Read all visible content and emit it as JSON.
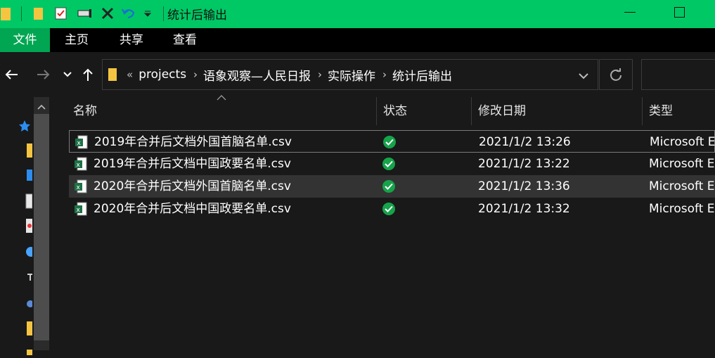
{
  "window": {
    "title": "统计后输出"
  },
  "ribbon": {
    "tabs": [
      {
        "label": "文件",
        "active": true
      },
      {
        "label": "主页",
        "active": false
      },
      {
        "label": "共享",
        "active": false
      },
      {
        "label": "查看",
        "active": false
      }
    ]
  },
  "address": {
    "overflow": "«",
    "crumbs": [
      "projects",
      "语象观察—人民日报",
      "实际操作",
      "统计后输出"
    ]
  },
  "columns": {
    "name": "名称",
    "status": "状态",
    "modified": "修改日期",
    "type": "类型"
  },
  "files": [
    {
      "name": "2019年合并后文档外国首脑名单.csv",
      "status": "synced",
      "modified": "2021/1/2 13:26",
      "type": "Microsoft E",
      "focused": true,
      "selected": false
    },
    {
      "name": "2019年合并后文档中国政要名单.csv",
      "status": "synced",
      "modified": "2021/1/2 13:22",
      "type": "Microsoft E",
      "focused": false,
      "selected": false
    },
    {
      "name": "2020年合并后文档外国首脑名单.csv",
      "status": "synced",
      "modified": "2021/1/2 13:36",
      "type": "Microsoft E",
      "focused": false,
      "selected": true
    },
    {
      "name": "2020年合并后文档中国政要名单.csv",
      "status": "synced",
      "modified": "2021/1/2 13:32",
      "type": "Microsoft E",
      "focused": false,
      "selected": false
    }
  ],
  "colors": {
    "accent": "#00c864",
    "active_tab": "#00a652",
    "status_ok": "#16a34a",
    "excel": "#1e7145"
  }
}
